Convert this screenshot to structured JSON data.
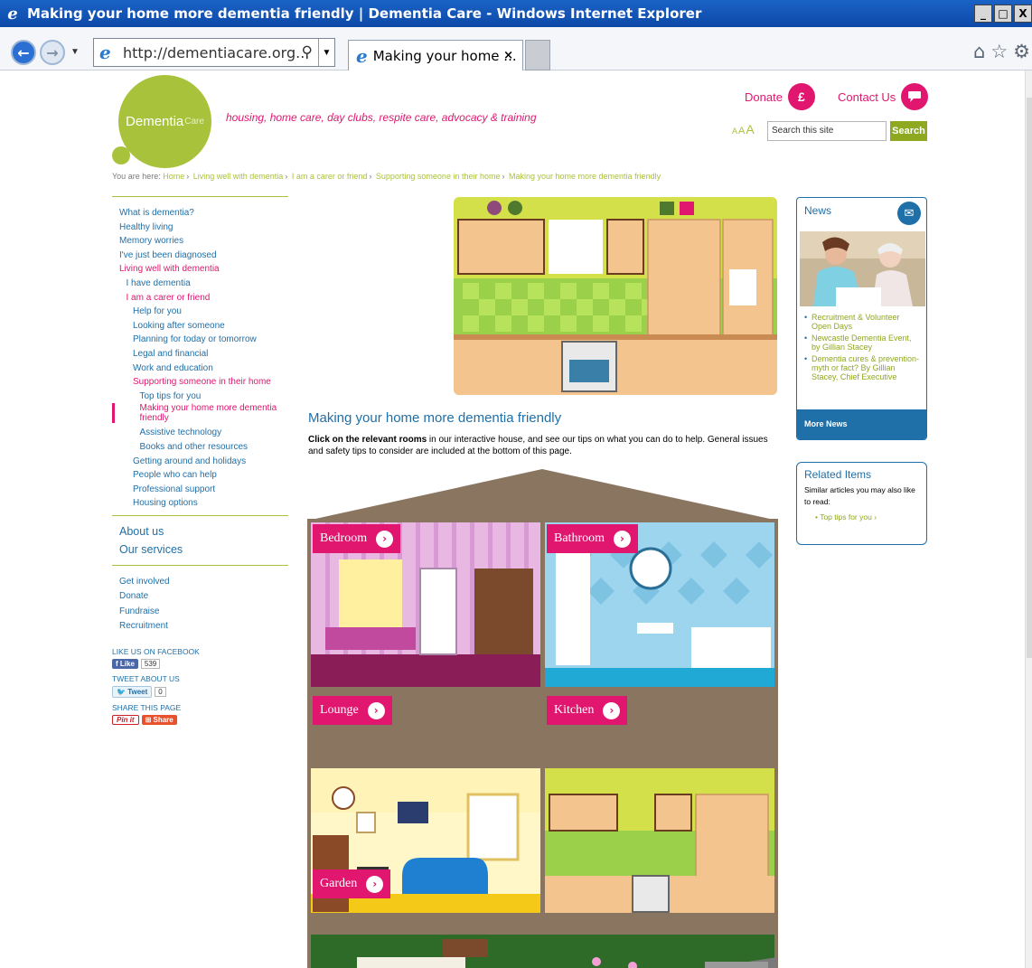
{
  "window": {
    "title": "Making your home more dementia friendly | Dementia Care - Windows Internet Explorer",
    "buttons": [
      "_",
      "□",
      "X"
    ]
  },
  "toolbar": {
    "url": "http://dementiacare.org...",
    "tab_label": "Making your home ...",
    "tab_close": "×"
  },
  "site": {
    "logo_main": "Dementia",
    "logo_small": "Care",
    "tagline": "housing, home care, day clubs, respite care, advocacy & training",
    "donate_label": "Donate",
    "donate_icon": "£",
    "contact_label": "Contact Us",
    "text_size": [
      "A",
      "A",
      "A"
    ],
    "search_placeholder": "Search this site",
    "search_button": "Search"
  },
  "breadcrumb": {
    "prefix": "You are here:",
    "items": [
      "Home",
      "Living well with dementia",
      "I am a carer or friend",
      "Supporting someone in their home",
      "Making your home more dementia friendly"
    ],
    "separator": "›"
  },
  "leftnav": {
    "items": [
      {
        "label": "What is dementia?",
        "indent": 0,
        "state": "normal"
      },
      {
        "label": "Healthy living",
        "indent": 0,
        "state": "normal"
      },
      {
        "label": "Memory worries",
        "indent": 0,
        "state": "normal"
      },
      {
        "label": "I've just been diagnosed",
        "indent": 0,
        "state": "normal"
      },
      {
        "label": "Living well with dementia",
        "indent": 0,
        "state": "active"
      },
      {
        "label": "I have dementia",
        "indent": 1,
        "state": "normal"
      },
      {
        "label": "I am a carer or friend",
        "indent": 1,
        "state": "active"
      },
      {
        "label": "Help for you",
        "indent": 2,
        "state": "normal"
      },
      {
        "label": "Looking after someone",
        "indent": 2,
        "state": "normal"
      },
      {
        "label": "Planning for today or tomorrow",
        "indent": 2,
        "state": "normal"
      },
      {
        "label": "Legal and financial",
        "indent": 2,
        "state": "normal"
      },
      {
        "label": "Work and education",
        "indent": 2,
        "state": "normal"
      },
      {
        "label": "Supporting someone in their home",
        "indent": 2,
        "state": "active"
      },
      {
        "label": "Top tips for you",
        "indent": 3,
        "state": "normal"
      },
      {
        "label": "Making your home more dementia friendly",
        "indent": 3,
        "state": "current"
      },
      {
        "label": "Assistive technology",
        "indent": 3,
        "state": "normal"
      },
      {
        "label": "Books and other resources",
        "indent": 3,
        "state": "normal"
      },
      {
        "label": "Getting around and holidays",
        "indent": 2,
        "state": "normal"
      },
      {
        "label": "People who can help",
        "indent": 2,
        "state": "normal"
      },
      {
        "label": "Professional support",
        "indent": 2,
        "state": "normal"
      },
      {
        "label": "Housing options",
        "indent": 2,
        "state": "normal"
      }
    ],
    "secondary": [
      "About us",
      "Our services"
    ],
    "tertiary": [
      "Get involved",
      "Donate",
      "Fundraise",
      "Recruitment"
    ],
    "social": {
      "facebook_head": "LIKE US ON FACEBOOK",
      "facebook_btn": "Like",
      "facebook_count": "539",
      "twitter_head": "TWEET ABOUT US",
      "twitter_btn": "Tweet",
      "twitter_count": "0",
      "share_head": "SHARE THIS PAGE",
      "pin_btn": "Pin it",
      "share_btn": "Share"
    }
  },
  "content": {
    "heading": "Making your home more dementia friendly",
    "intro_bold": "Click on the relevant rooms",
    "intro_rest": " in our interactive house, and see our tips on what you can do to help. General issues and safety tips to consider are included at the bottom of this page.",
    "rooms": [
      "Bedroom",
      "Bathroom",
      "Lounge",
      "Kitchen",
      "Garden"
    ],
    "room_arrow": "›"
  },
  "sidebar": {
    "news_title": "News",
    "news_items": [
      "Recruitment & Volunteer Open Days",
      "Newcastle Dementia Event, by Gillian Stacey",
      "Dementia cures & prevention- myth or fact? By Gillian Stacey, Chief Executive"
    ],
    "more_news": "More News",
    "related_title": "Related Items",
    "related_sub": "Similar articles you may also like to read:",
    "related_link": "Top tips for you ›"
  },
  "colors": {
    "brand_green": "#a9c23c",
    "brand_pink": "#e0166f",
    "link_blue": "#1f6fa8"
  }
}
